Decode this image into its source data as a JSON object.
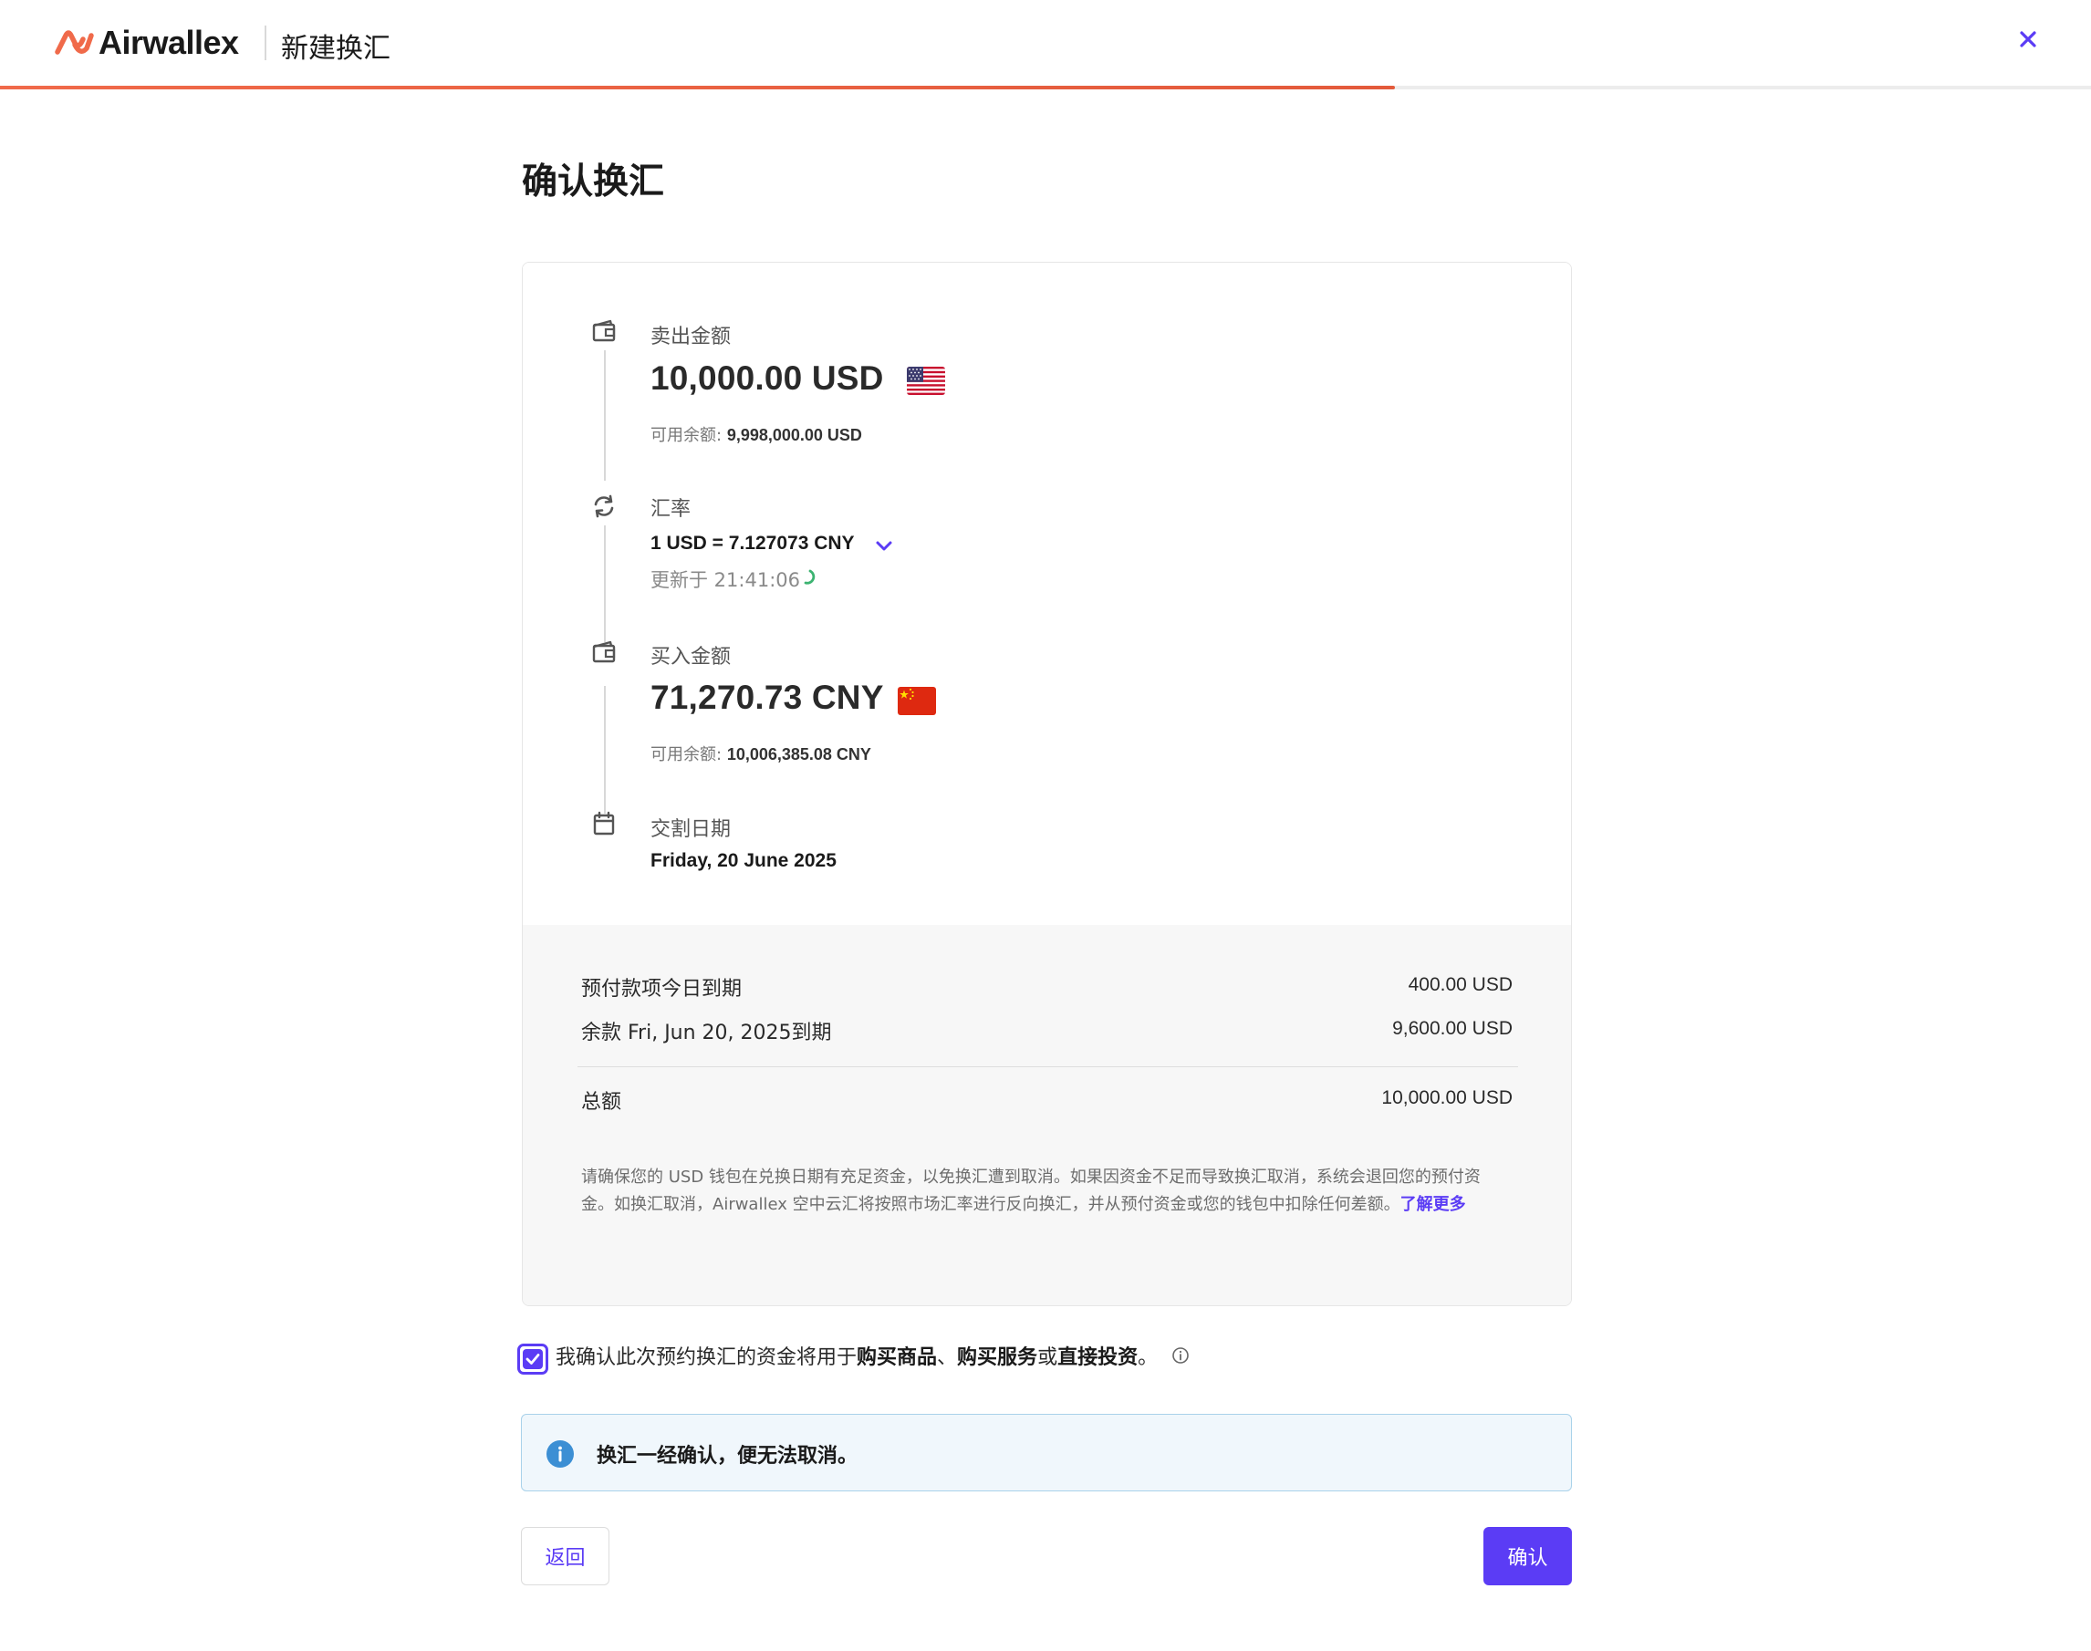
{
  "header": {
    "brand": "Airwallex",
    "title": "新建换汇",
    "progress": 0.667
  },
  "page": {
    "title": "确认换汇"
  },
  "sell": {
    "label": "卖出金额",
    "amount": "10,000.00 USD",
    "flag": "us-flag",
    "available_label": "可用余额:",
    "available_value": "9,998,000.00 USD"
  },
  "rate": {
    "label": "汇率",
    "value": "1 USD = 7.127073 CNY",
    "updated": "更新于 21:41:06"
  },
  "buy": {
    "label": "买入金额",
    "amount": "71,270.73 CNY",
    "flag": "cn-flag",
    "available_label": "可用余额:",
    "available_value": "10,006,385.08 CNY"
  },
  "settlement": {
    "label": "交割日期",
    "date": "Friday, 20 June 2025"
  },
  "summary": {
    "rows": [
      {
        "label": "预付款项今日到期",
        "value": "400.00 USD"
      },
      {
        "label": "余款 Fri, Jun 20, 2025到期",
        "value": "9,600.00 USD"
      }
    ],
    "total_label": "总额",
    "total_value": "10,000.00 USD",
    "disclaimer": "请确保您的 USD 钱包在兑换日期有充足资金，以免换汇遭到取消。如果因资金不足而导致换汇取消，系统会退回您的预付资金。如换汇取消，Airwallex 空中云汇将按照市场汇率进行反向换汇，并从预付资金或您的钱包中扣除任何差额。",
    "learn_more": "了解更多"
  },
  "confirmation": {
    "checked": true,
    "text_1": "我确认此次预约换汇的资金将用于",
    "bold_1": "购买商品",
    "sep_1": "、",
    "bold_2": "购买服务",
    "sep_2": "或",
    "bold_3": "直接投资",
    "text_end": "。"
  },
  "banner": {
    "text": "换汇一经确认，便无法取消。"
  },
  "buttons": {
    "back": "返回",
    "confirm": "确认"
  },
  "colors": {
    "accent": "#5b3cf5",
    "brand_orange": "#f06a4a",
    "spinner_green": "#3cb371",
    "banner_border": "#a9d2ea",
    "banner_icon": "#3c8fd4"
  }
}
